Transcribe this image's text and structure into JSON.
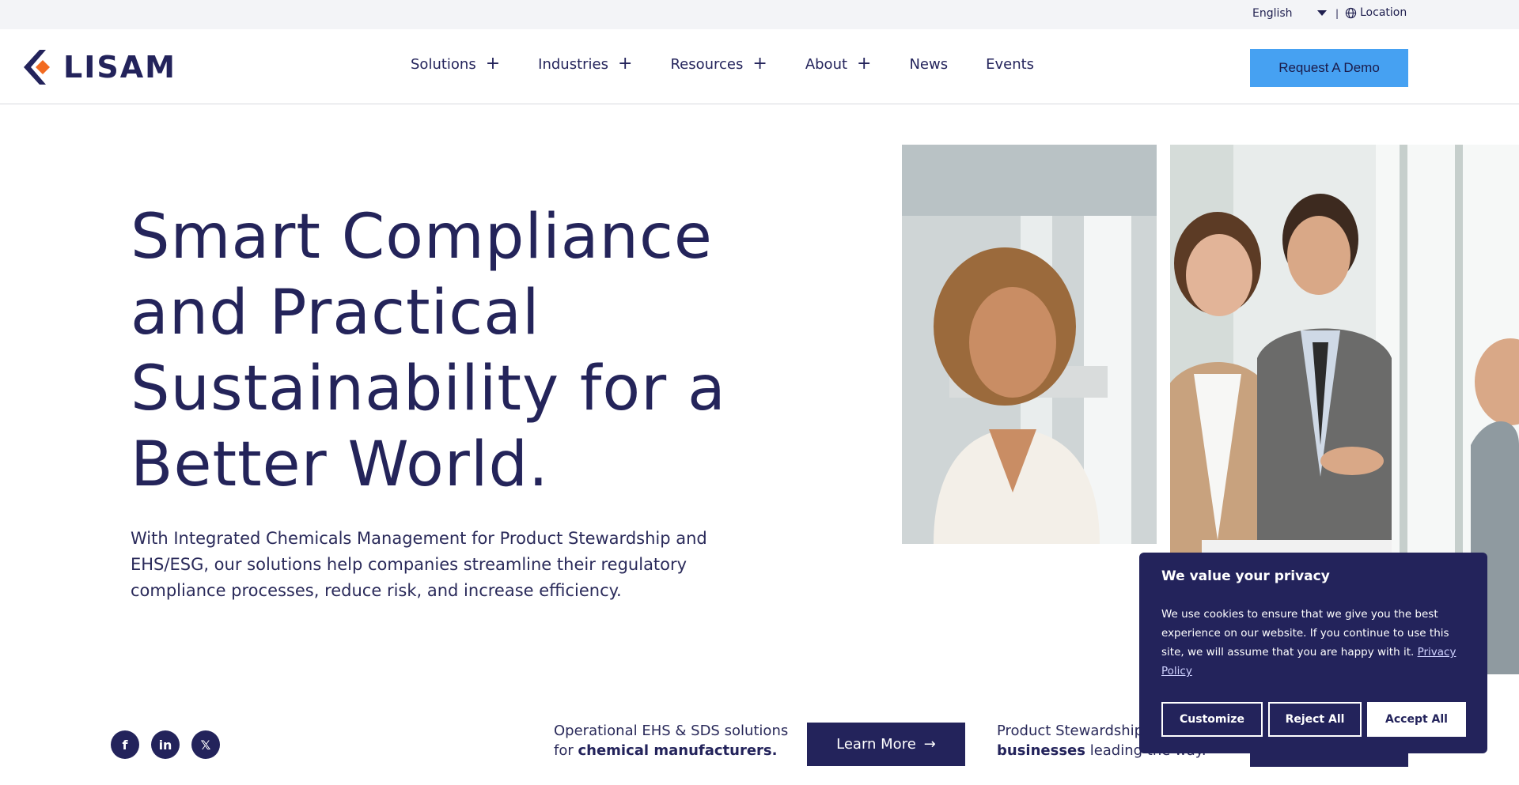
{
  "topbar": {
    "language": "English",
    "separator": "|",
    "location": "Location"
  },
  "header": {
    "logo_text": "LISAM",
    "nav": [
      {
        "label": "Solutions",
        "has_plus": true
      },
      {
        "label": "Industries",
        "has_plus": true
      },
      {
        "label": "Resources",
        "has_plus": true
      },
      {
        "label": "About",
        "has_plus": true
      },
      {
        "label": "News",
        "has_plus": false
      },
      {
        "label": "Events",
        "has_plus": false
      }
    ],
    "plus": "+",
    "cta": "Request A Demo"
  },
  "hero": {
    "title": "Smart Compliance and Practical Sustainability for a Better World.",
    "subtitle": "With Integrated Chemicals Management for Product Stewardship and EHS/ESG, our solutions help companies streamline their regulatory compliance processes, reduce risk, and increase efficiency."
  },
  "social": [
    {
      "icon": "facebook-icon",
      "glyph": "f"
    },
    {
      "icon": "linkedin-icon",
      "glyph": "in"
    },
    {
      "icon": "x-icon",
      "glyph": "𝕏"
    }
  ],
  "promos": {
    "first": {
      "text": "Operational EHS & SDS solutions for ",
      "bold": "chemical manufacturers."
    },
    "learn_more": "Learn More",
    "arrow": "→",
    "second": {
      "text": "Product Stewardship",
      "bold": "businesses",
      "tail": " leading the way."
    }
  },
  "cookie": {
    "title": "We value your privacy",
    "body": "We use cookies to ensure that we give you the best experience on our website. If you continue to use this site, we will assume that you are happy with it.",
    "link": "Privacy Policy",
    "customize": "Customize",
    "reject": "Reject All",
    "accept": "Accept All"
  },
  "colors": {
    "navy": "#23235b",
    "accent_blue": "#46a1f2",
    "logo_orange": "#f26b21"
  }
}
